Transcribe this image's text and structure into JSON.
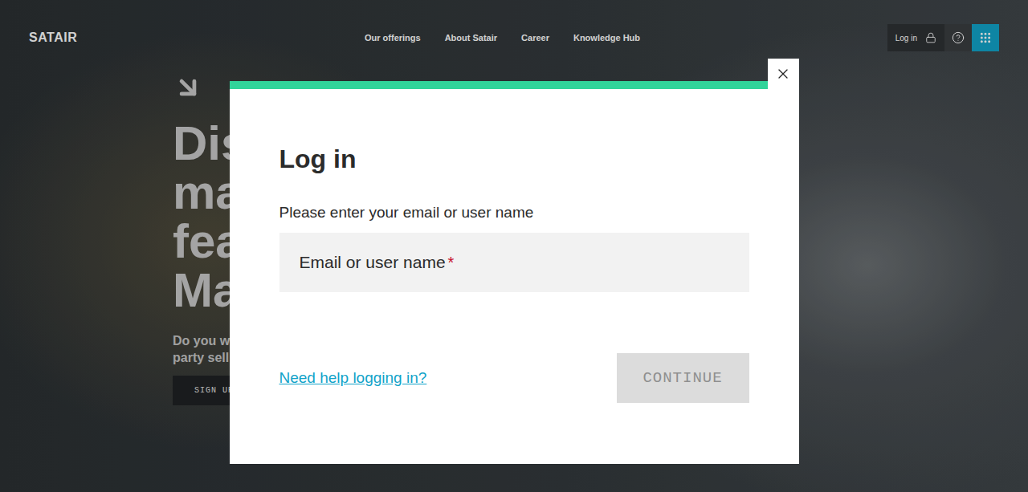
{
  "header": {
    "logo": "SATAIR",
    "nav": [
      "Our offerings",
      "About Satair",
      "Career",
      "Knowledge Hub"
    ],
    "login": "Log in"
  },
  "hero": {
    "headline_lines": [
      "Dis",
      "ma",
      "fea",
      "Ma"
    ],
    "intro_lines": [
      "Do you w",
      "party sell"
    ],
    "cta": "SIGN UP"
  },
  "modal": {
    "title": "Log in",
    "prompt": "Please enter your email or user name",
    "field": {
      "label": "Email or user name",
      "required_mark": "*"
    },
    "help_link": "Need help logging in?",
    "continue": {
      "label": "CONTINUE",
      "disabled": true
    }
  }
}
